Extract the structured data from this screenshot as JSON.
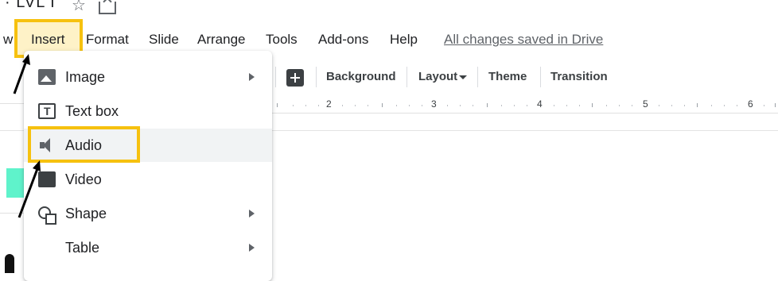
{
  "title": {
    "text": "· LVL I"
  },
  "menubar": {
    "cut_label": "w",
    "items": [
      "Insert",
      "Format",
      "Slide",
      "Arrange",
      "Tools",
      "Add-ons",
      "Help"
    ],
    "save_status": "All changes saved in Drive"
  },
  "toolbar": {
    "background": "Background",
    "layout": "Layout",
    "theme": "Theme",
    "transition": "Transition"
  },
  "ruler": {
    "numbers": [
      "2",
      "3",
      "4",
      "5",
      "6"
    ]
  },
  "insert_menu": {
    "items": [
      {
        "label": "Image",
        "icon": "image-icon",
        "submenu": true
      },
      {
        "label": "Text box",
        "icon": "text-box-icon",
        "submenu": false
      },
      {
        "label": "Audio",
        "icon": "audio-icon",
        "submenu": false,
        "active": true
      },
      {
        "label": "Video",
        "icon": "video-icon",
        "submenu": false
      },
      {
        "label": "Shape",
        "icon": "shape-icon",
        "submenu": true
      },
      {
        "label": "Table",
        "icon": "",
        "submenu": true
      }
    ]
  },
  "colors": {
    "highlight": "#f6c10f",
    "thumbnail": "#5ff3cb",
    "active_row": "#f1f3f4"
  }
}
